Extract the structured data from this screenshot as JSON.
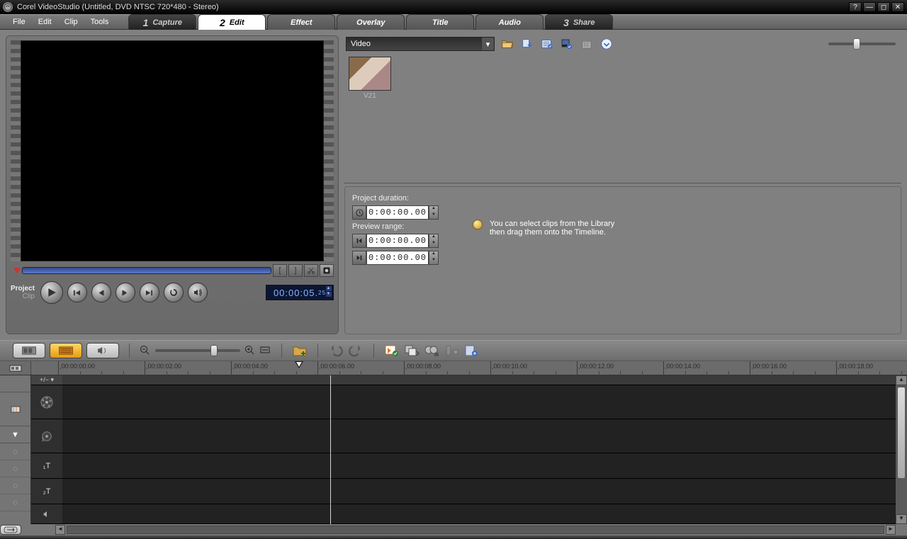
{
  "titlebar": {
    "text": "Corel VideoStudio (Untitled, DVD NTSC 720*480 - Stereo)"
  },
  "menu": {
    "items": [
      "File",
      "Edit",
      "Clip",
      "Tools"
    ]
  },
  "steps": {
    "capture": {
      "num": "1",
      "label": "Capture"
    },
    "edit": {
      "num": "2",
      "label": "Edit"
    },
    "effect": {
      "label": "Effect"
    },
    "overlay": {
      "label": "Overlay"
    },
    "title": {
      "label": "Title"
    },
    "audio": {
      "label": "Audio"
    },
    "share": {
      "num": "3",
      "label": "Share"
    }
  },
  "preview": {
    "mode_project": "Project",
    "mode_clip": "Clip",
    "timecode": "00:00:05.",
    "timecode_frames": "25"
  },
  "library": {
    "dropdown": "Video",
    "thumb1": "V21"
  },
  "options": {
    "project_duration_label": "Project duration:",
    "project_duration": "0:00:00.00",
    "preview_range_label": "Preview range:",
    "preview_from": "0:00:00.00",
    "preview_to": "0:00:00.00",
    "hint_line1": "You can select clips from the Library",
    "hint_line2": "then drag them onto the Timeline."
  },
  "ruler": {
    "ticks": [
      "00:00:00.00",
      "00:00:02.00",
      "00:00:04.00",
      "00:00:06.00",
      "00:00:08.00",
      "00:00:10.00",
      "00:00:12.00",
      "00:00:14.00",
      "00:00:16.00",
      "00:00:18.00"
    ]
  },
  "tracks": {
    "plusminus": "+/− ▾",
    "title1": "₁T",
    "title2": "₂T"
  }
}
